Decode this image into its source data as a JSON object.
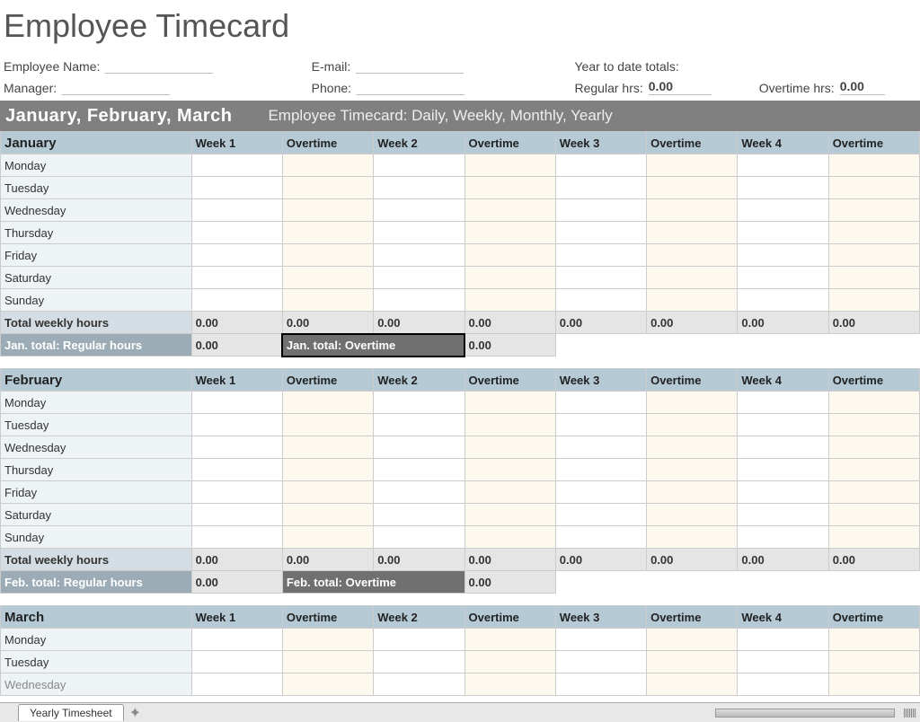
{
  "title": "Employee Timecard",
  "info": {
    "employee_name_label": "Employee Name:",
    "employee_name": "",
    "email_label": "E-mail:",
    "email": "",
    "ytd_label": "Year to date totals:",
    "manager_label": "Manager:",
    "manager": "",
    "phone_label": "Phone:",
    "phone": "",
    "reg_label": "Regular hrs:",
    "reg_val": "0.00",
    "ot_label": "Overtime hrs:",
    "ot_val": "0.00"
  },
  "banner": {
    "title": "January, February, March",
    "sub": "Employee Timecard: Daily, Weekly, Monthly, Yearly"
  },
  "cols": {
    "week1": "Week 1",
    "ot1": "Overtime",
    "week2": "Week 2",
    "ot2": "Overtime",
    "week3": "Week 3",
    "ot3": "Overtime",
    "week4": "Week 4",
    "ot4": "Overtime"
  },
  "days": {
    "mon": "Monday",
    "tue": "Tuesday",
    "wed": "Wednesday",
    "thu": "Thursday",
    "fri": "Friday",
    "sat": "Saturday",
    "sun": "Sunday"
  },
  "months": {
    "jan": {
      "name": "January",
      "total_label": "Total weekly hours",
      "totals": [
        "0.00",
        "0.00",
        "0.00",
        "0.00",
        "0.00",
        "0.00",
        "0.00",
        "0.00"
      ],
      "reg_label": "Jan. total: Regular hours",
      "reg_val": "0.00",
      "ot_label": "Jan. total: Overtime",
      "ot_val": "0.00"
    },
    "feb": {
      "name": "February",
      "total_label": "Total weekly hours",
      "totals": [
        "0.00",
        "0.00",
        "0.00",
        "0.00",
        "0.00",
        "0.00",
        "0.00",
        "0.00"
      ],
      "reg_label": "Feb. total: Regular hours",
      "reg_val": "0.00",
      "ot_label": "Feb.  total: Overtime",
      "ot_val": "0.00"
    },
    "mar": {
      "name": "March"
    }
  },
  "tab": {
    "name": "Yearly Timesheet"
  }
}
